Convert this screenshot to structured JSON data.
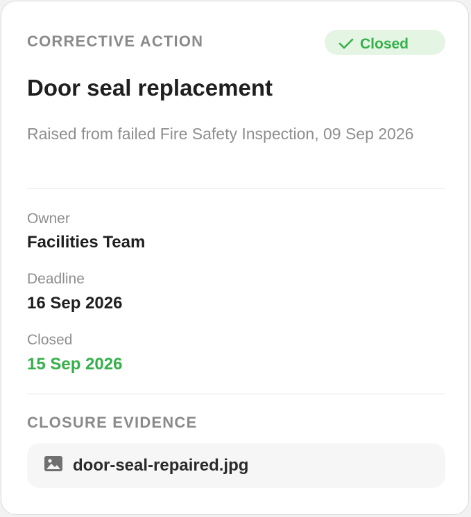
{
  "card": {
    "eyebrow": "CORRECTIVE ACTION",
    "status_badge": {
      "label": "Closed",
      "icon": "check-icon",
      "color": "#35b04a",
      "background": "#e4f5e4"
    },
    "title": "Door seal replacement",
    "subtitle": "Raised from failed Fire Safety Inspection, 09 Sep 2026"
  },
  "details": {
    "owner": {
      "label": "Owner",
      "value": "Facilities Team"
    },
    "deadline": {
      "label": "Deadline",
      "value": "16 Sep 2026"
    },
    "closed": {
      "label": "Closed",
      "value": "15 Sep 2026",
      "color": "#35b04a"
    }
  },
  "evidence": {
    "heading": "CLOSURE EVIDENCE",
    "files": [
      {
        "name": "door-seal-repaired.jpg",
        "icon": "image-icon"
      }
    ]
  }
}
